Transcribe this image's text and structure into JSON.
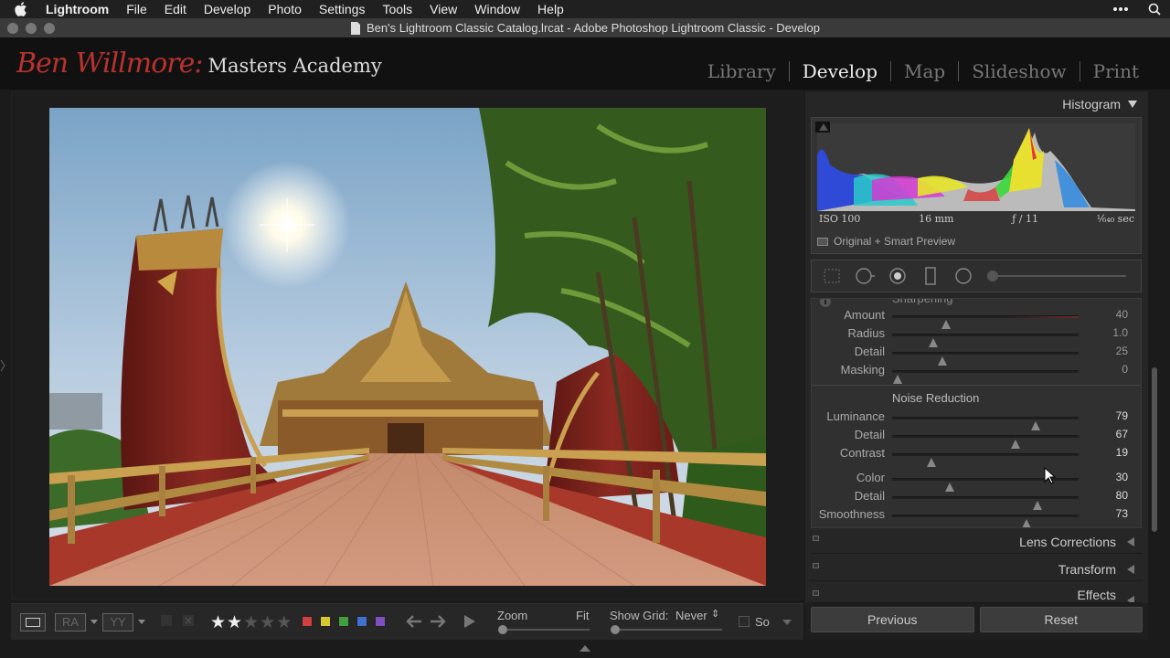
{
  "menubar": {
    "app": "Lightroom",
    "items": [
      "File",
      "Edit",
      "Develop",
      "Photo",
      "Settings",
      "Tools",
      "View",
      "Window",
      "Help"
    ]
  },
  "window": {
    "title": "Ben's Lightroom Classic Catalog.lrcat - Adobe Photoshop Lightroom Classic - Develop"
  },
  "header": {
    "logo_script": "Ben Willmore:",
    "logo_text": "Masters Academy",
    "modules": [
      "Library",
      "Develop",
      "Map",
      "Slideshow",
      "Print"
    ],
    "active_module": "Develop"
  },
  "histogram": {
    "title": "Histogram",
    "iso": "ISO 100",
    "focal": "16 mm",
    "aperture": "ƒ / 11",
    "shutter": "¹⁄₆₄₀ sec",
    "preview": "Original + Smart Preview"
  },
  "detail": {
    "section_cut": "Sharpening",
    "sharpening": [
      {
        "label": "Amount",
        "value": "40",
        "pos": 0.29
      },
      {
        "label": "Radius",
        "value": "1.0",
        "pos": 0.22
      },
      {
        "label": "Detail",
        "value": "25",
        "pos": 0.27
      },
      {
        "label": "Masking",
        "value": "0",
        "pos": 0.03
      }
    ],
    "noise_title": "Noise Reduction",
    "noise": [
      {
        "label": "Luminance",
        "value": "79",
        "pos": 0.77
      },
      {
        "label": "Detail",
        "value": "67",
        "pos": 0.66
      },
      {
        "label": "Contrast",
        "value": "19",
        "pos": 0.21
      }
    ],
    "color": [
      {
        "label": "Color",
        "value": "30",
        "pos": 0.31
      },
      {
        "label": "Detail",
        "value": "80",
        "pos": 0.78
      },
      {
        "label": "Smoothness",
        "value": "73",
        "pos": 0.72
      }
    ]
  },
  "panels": [
    "Lens Corrections",
    "Transform",
    "Effects"
  ],
  "buttons": {
    "previous": "Previous",
    "reset": "Reset"
  },
  "toolbar": {
    "rating": 2,
    "zoom_label": "Zoom",
    "fit_label": "Fit",
    "grid_label": "Show Grid:",
    "grid_value": "Never",
    "soft_label": "So",
    "ra_label": "RA",
    "yy_label": "YY",
    "colors": [
      "#d04040",
      "#d8c830",
      "#40a040",
      "#4070d0",
      "#8050c0"
    ]
  }
}
